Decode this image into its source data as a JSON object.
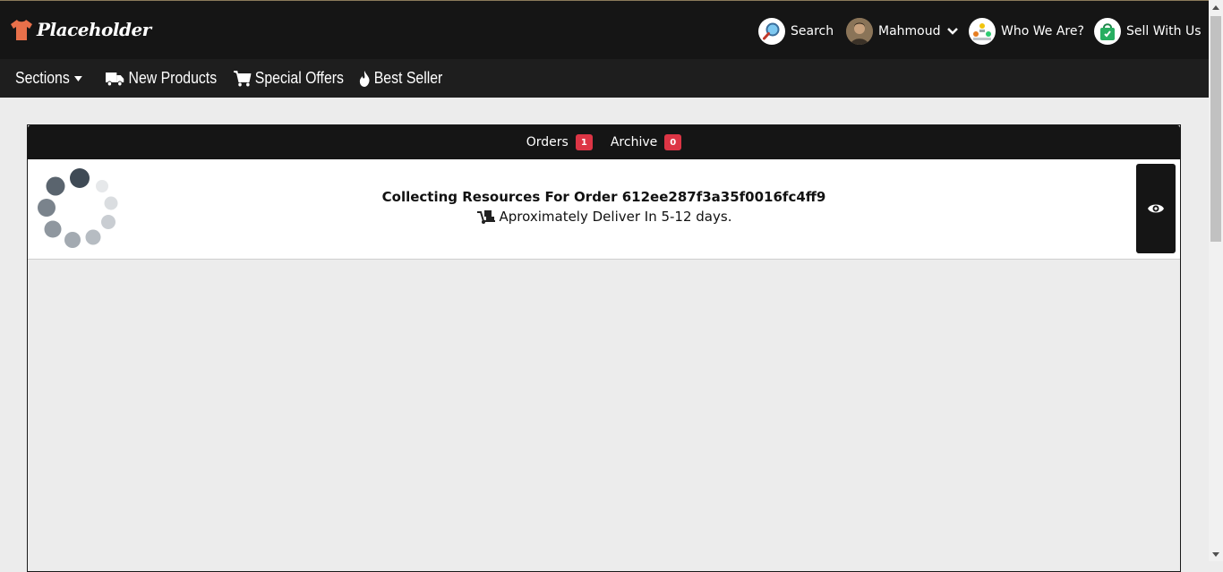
{
  "header": {
    "logo_text": "Placeholder",
    "search_label": "Search",
    "user_label": "Mahmoud",
    "who_label": "Who We Are?",
    "sell_label": "Sell With Us"
  },
  "nav": {
    "sections_label": "Sections",
    "new_products_label": "New Products",
    "special_offers_label": "Special Offers",
    "best_seller_label": "Best Seller"
  },
  "tabs": {
    "orders_label": "Orders",
    "orders_count": "1",
    "archive_label": "Archive",
    "archive_count": "0"
  },
  "order": {
    "title": "Collecting Resources For Order 612ee287f3a35f0016fc4ff9",
    "delivery": "Aproximately Deliver In 5-12 days."
  },
  "colors": {
    "topbar_bg": "#151515",
    "navbar_bg": "#1e1e1e",
    "badge": "#dc3545",
    "logo_shirt": "#e8704a"
  },
  "icons": {
    "logo": "shirt-icon",
    "search": "magnifier-icon",
    "user": "avatar",
    "who": "team-icon",
    "sell": "shopping-bag-icon",
    "sections": "caret-down-icon",
    "new_products": "truck-icon",
    "special_offers": "cart-icon",
    "best_seller": "fire-icon",
    "delivery": "dolly-icon",
    "view": "eye-icon",
    "loading": "spinner-icon"
  }
}
